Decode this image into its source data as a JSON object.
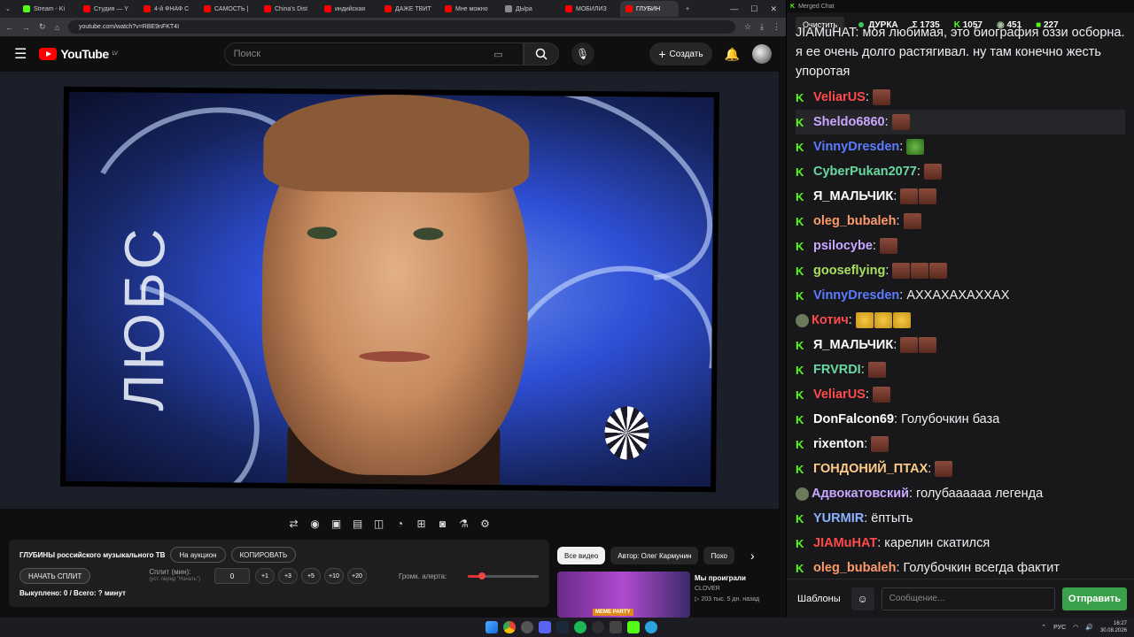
{
  "browser": {
    "tabs": [
      {
        "label": "Stream - Ki",
        "color": "#53fc18"
      },
      {
        "label": "Студия — Y",
        "color": "#ff0000"
      },
      {
        "label": "4-й ФНАФ С",
        "color": "#ff0000"
      },
      {
        "label": "САМОСТЬ |",
        "color": "#ff0000"
      },
      {
        "label": "China's Dist",
        "color": "#ff0000"
      },
      {
        "label": "индийская",
        "color": "#ff0000"
      },
      {
        "label": "ДАЖЕ ТВИТ",
        "color": "#ff0000"
      },
      {
        "label": "Мне можно",
        "color": "#ff0000"
      },
      {
        "label": "ДЫра",
        "color": "#888888"
      },
      {
        "label": "МОБИЛИЗ",
        "color": "#ff0000"
      },
      {
        "label": "ГЛУБИН",
        "color": "#ff0000"
      }
    ],
    "url": "youtube.com/watch?v=RBE9nFKT4I"
  },
  "youtube": {
    "logo_text": "YouTube",
    "region": "LV",
    "search_placeholder": "Поиск",
    "create_label": "Создать"
  },
  "video": {
    "overlay_text": "ЛЮБС"
  },
  "panel": {
    "title": "ГЛУБИНЫ российского музыкального ТВ",
    "auction_label": "На аукцион",
    "copy_label": "КОПИРОВАТЬ",
    "start_split_label": "НАЧАТЬ СПЛИТ",
    "split_label": "Сплит (мин):",
    "split_hint": "(уст. перед \"Начать\")",
    "split_value": "0",
    "increments": [
      "+1",
      "+3",
      "+5",
      "+10",
      "+20"
    ],
    "alert_volume_label": "Громк. алерта:",
    "alert_volume": 0.2,
    "paid_label": "Выкуплено: 0 / Всего: ? минут"
  },
  "recommendations": {
    "chips": [
      "Все видео",
      "Автор: Олег Кармунин",
      "Похо"
    ],
    "video_title": "Мы проиграли",
    "channel": "CLOVER",
    "meta": "▷ 203 тыс.   5 дн. назад",
    "badge": "MEME PARTY"
  },
  "chat": {
    "window_title": "Merged Chat",
    "clear_label": "Очистить",
    "status_name": "ДУРКА",
    "stat_total": "Σ 1735",
    "stat_kick": "1057",
    "stat_b": "451",
    "stat_c": "227",
    "top_message": "JIAMuHAT: моя любимая, это биография оззи осборна. я ее очень долго растягивал. ну там конечно жесть упоротая",
    "messages": [
      {
        "nick": "VeliarUS",
        "color": "#ff4a4a",
        "text": "",
        "emotes": 1,
        "badge": "k"
      },
      {
        "nick": "Sheldo6860",
        "color": "#c8a8ff",
        "text": "",
        "emotes": 1,
        "badge": "k"
      },
      {
        "nick": "VinnyDresden",
        "color": "#5a7dff",
        "text": "",
        "emotes": 1,
        "badge": "k",
        "emote": "pepe"
      },
      {
        "nick": "CyberPukan2077",
        "color": "#6ad9a0",
        "text": "",
        "emotes": 1,
        "badge": "k"
      },
      {
        "nick": "Я_МАЛЬЧИК",
        "color": "#ffffff",
        "text": "",
        "emotes": 2,
        "badge": "k"
      },
      {
        "nick": "oleg_bubaleh",
        "color": "#ff9a6a",
        "text": "",
        "emotes": 1,
        "badge": "k"
      },
      {
        "nick": "psilocybe",
        "color": "#c8a8ff",
        "text": "",
        "emotes": 1,
        "badge": "k"
      },
      {
        "nick": "gooseflying",
        "color": "#a8e060",
        "text": "",
        "emotes": 3,
        "badge": "k"
      },
      {
        "nick": "VinnyDresden",
        "color": "#5a7dff",
        "text": "АХХАХАХАХХАХ",
        "emotes": 0,
        "badge": "k"
      },
      {
        "nick": "Котич",
        "color": "#ff4a4a",
        "text": "",
        "emotes": 3,
        "badge": "u",
        "emote": "laugh"
      },
      {
        "nick": "Я_МАЛЬЧИК",
        "color": "#ffffff",
        "text": "",
        "emotes": 2,
        "badge": "k"
      },
      {
        "nick": "FRVRDI",
        "color": "#6ad9a0",
        "text": "",
        "emotes": 1,
        "badge": "k"
      },
      {
        "nick": "VeliarUS",
        "color": "#ff4a4a",
        "text": "",
        "emotes": 1,
        "badge": "k"
      },
      {
        "nick": "DonFalcon69",
        "color": "#ffffff",
        "text": "Голубочкин база",
        "emotes": 0,
        "badge": "k"
      },
      {
        "nick": "rixenton",
        "color": "#ffffff",
        "text": "",
        "emotes": 1,
        "badge": "k"
      },
      {
        "nick": "ГОНДОНИЙ_ПТАХ",
        "color": "#ffcc88",
        "text": "",
        "emotes": 1,
        "badge": "k"
      },
      {
        "nick": "Адвокатовский",
        "color": "#c8a8ff",
        "text": "голубаааааа легенда",
        "emotes": 0,
        "badge": "u"
      },
      {
        "nick": "YURMIR",
        "color": "#8ab4ff",
        "text": "ёптыть",
        "emotes": 0,
        "badge": "k"
      },
      {
        "nick": "JIAMuHAT",
        "color": "#ff4a4a",
        "text": "карелин скатился",
        "emotes": 0,
        "badge": "k"
      },
      {
        "nick": "oleg_bubaleh",
        "color": "#ff9a6a",
        "text": "Голубочкин всегда фактит",
        "emotes": 0,
        "badge": "k"
      }
    ],
    "templates_label": "Шаблоны",
    "input_placeholder": "Сообщение...",
    "send_label": "Отправить"
  },
  "taskbar": {
    "lang": "РУС",
    "time": "16:27",
    "date": "30.08.2026"
  }
}
